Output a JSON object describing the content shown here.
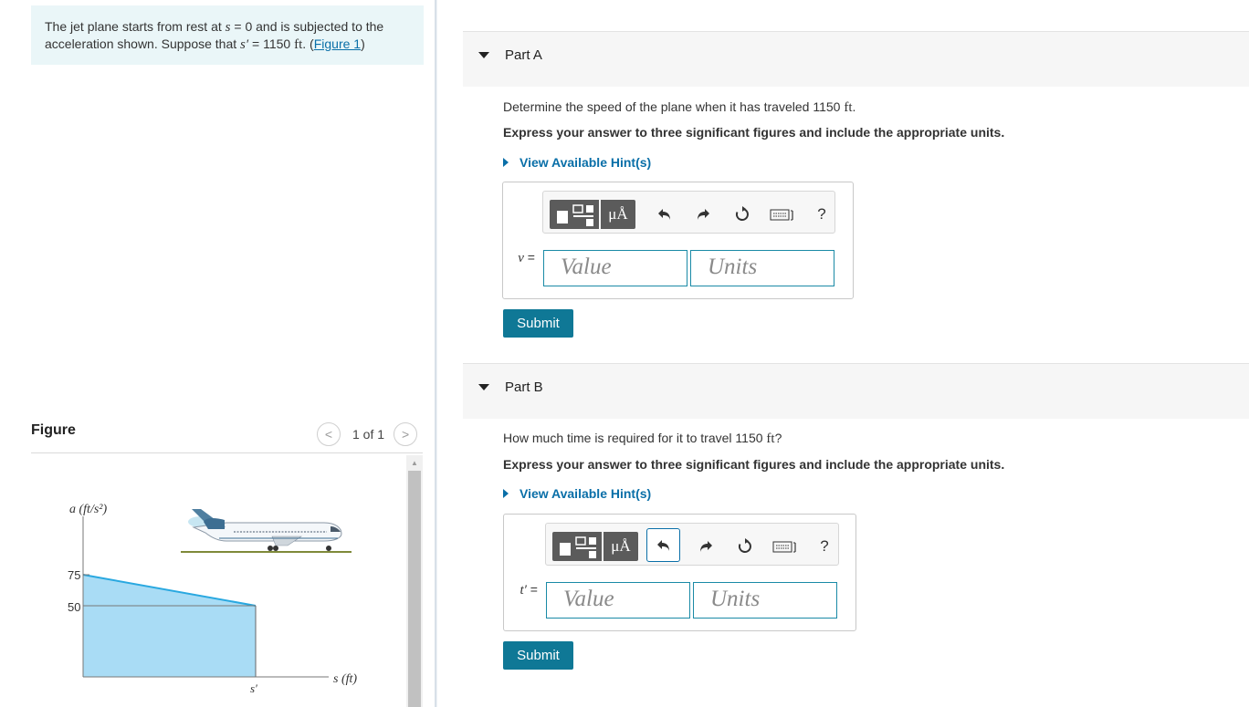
{
  "problem": {
    "text_1": "The jet plane starts from rest at ",
    "var_s": "s",
    "text_2": " = 0 and is subjected to the acceleration shown. Suppose that ",
    "var_s_prime": "s′",
    "text_3": " = 1150 ",
    "unit": "ft",
    "text_4": ". (",
    "figure_link": "Figure 1",
    "text_5": ")"
  },
  "figure": {
    "title": "Figure",
    "nav_prev": "<",
    "nav_count": "1 of 1",
    "nav_next": ">",
    "y_axis_label": "a (ft/s²)",
    "x_axis_label": "s (ft)",
    "y_tick_75": "75",
    "y_tick_50": "50",
    "x_tick_sprime": "s′",
    "series": {
      "start_a": 75,
      "end_a": 50
    },
    "fill_color": "#a9dcf5",
    "line_color": "#29a8e0"
  },
  "toolbar": {
    "mu_label": "μÅ",
    "help_label": "?"
  },
  "part_a": {
    "title": "Part A",
    "question_1": "Determine the speed of the plane when it has traveled 1150 ",
    "question_unit": "ft",
    "question_2": ".",
    "express": "Express your answer to three significant figures and include the appropriate units.",
    "hint": "View Available Hint(s)",
    "var": "v",
    "eq": " =",
    "value_placeholder": "Value",
    "units_placeholder": "Units",
    "submit": "Submit"
  },
  "part_b": {
    "title": "Part B",
    "question_1": "How much time is required for it to travel 1150 ",
    "question_unit": "ft",
    "question_2": "?",
    "express": "Express your answer to three significant figures and include the appropriate units.",
    "hint": "View Available Hint(s)",
    "var": "t′",
    "eq": " =",
    "value_placeholder": "Value",
    "units_placeholder": "Units",
    "submit": "Submit"
  },
  "colors": {
    "accent": "#0f7896",
    "link": "#0a6fa8",
    "problem_bg": "#eaf6f8"
  }
}
